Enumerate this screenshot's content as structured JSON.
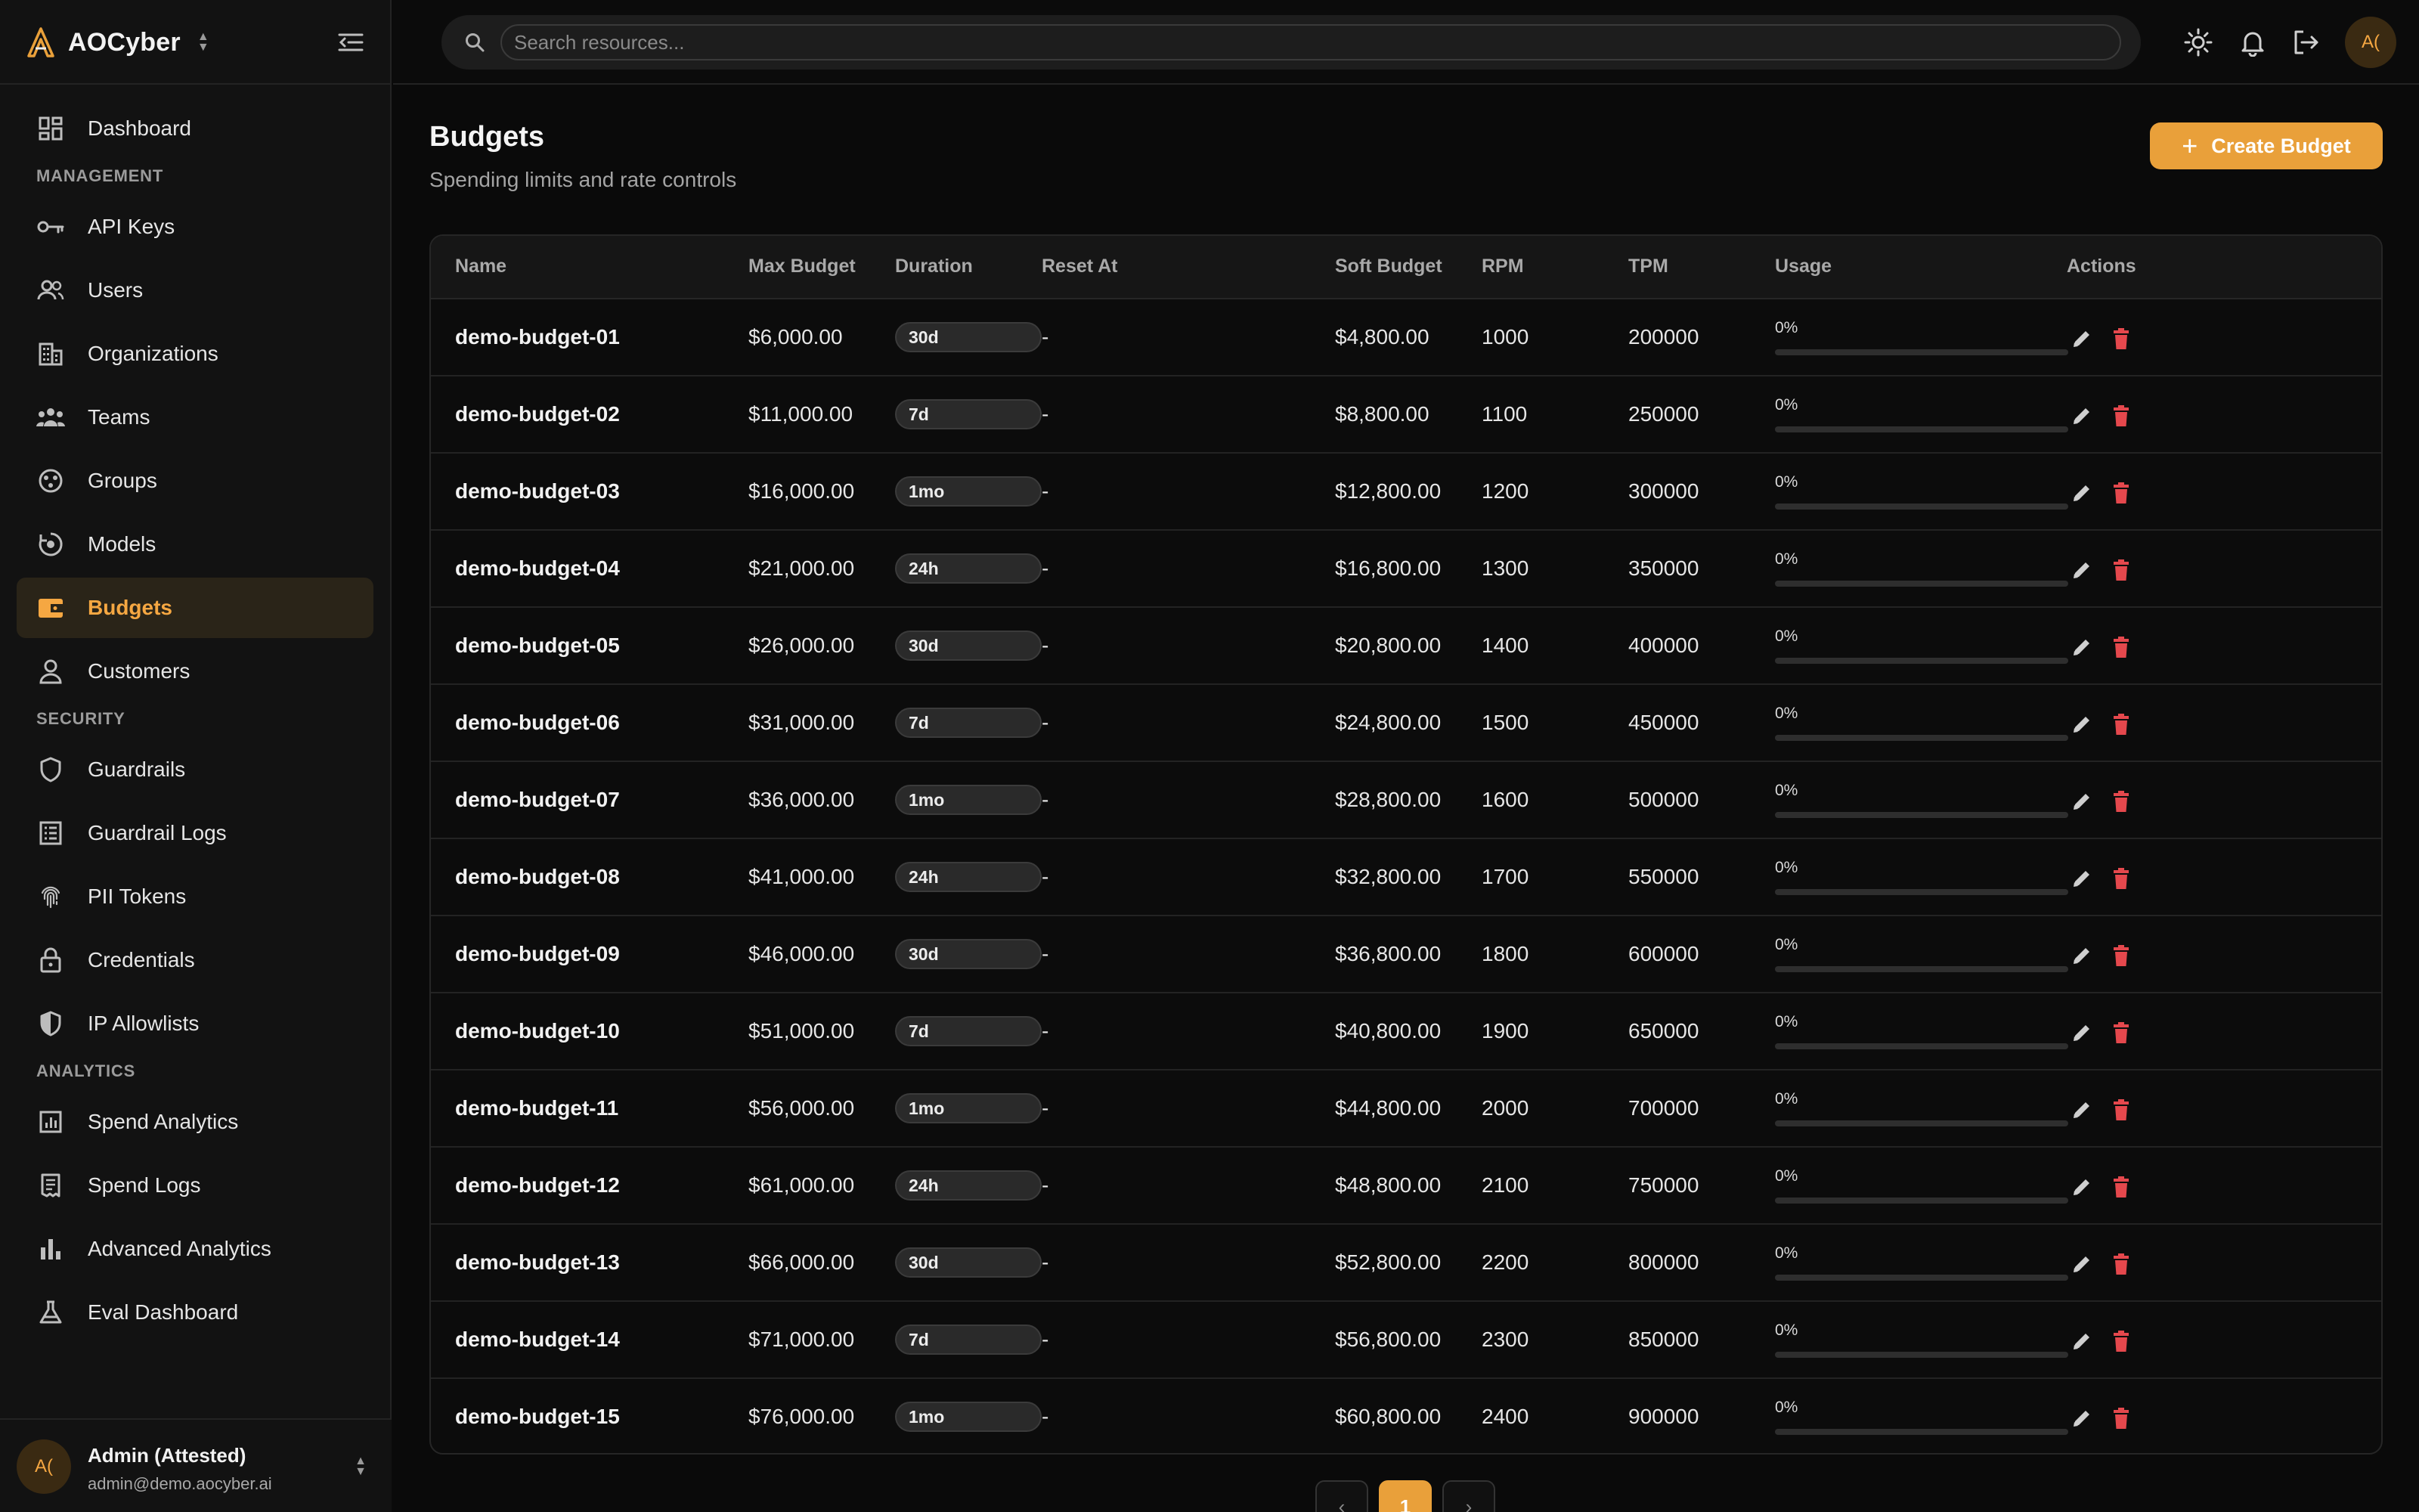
{
  "app": {
    "name": "AOCyber"
  },
  "search": {
    "placeholder": "Search resources..."
  },
  "sidebar": {
    "top_items": [
      {
        "label": "Dashboard",
        "icon": "dashboard-icon"
      }
    ],
    "sections": [
      {
        "title": "MANAGEMENT",
        "items": [
          {
            "label": "API Keys",
            "icon": "key-icon"
          },
          {
            "label": "Users",
            "icon": "users-icon"
          },
          {
            "label": "Organizations",
            "icon": "building-icon"
          },
          {
            "label": "Teams",
            "icon": "team-icon"
          },
          {
            "label": "Groups",
            "icon": "groups-icon"
          },
          {
            "label": "Models",
            "icon": "model-icon"
          },
          {
            "label": "Budgets",
            "icon": "wallet-icon",
            "active": true
          },
          {
            "label": "Customers",
            "icon": "person-icon"
          }
        ]
      },
      {
        "title": "SECURITY",
        "items": [
          {
            "label": "Guardrails",
            "icon": "shield-icon"
          },
          {
            "label": "Guardrail Logs",
            "icon": "list-icon"
          },
          {
            "label": "PII Tokens",
            "icon": "fingerprint-icon"
          },
          {
            "label": "Credentials",
            "icon": "lock-icon"
          },
          {
            "label": "IP Allowlists",
            "icon": "shield-half-icon"
          }
        ]
      },
      {
        "title": "ANALYTICS",
        "items": [
          {
            "label": "Spend Analytics",
            "icon": "analytics-icon"
          },
          {
            "label": "Spend Logs",
            "icon": "receipt-icon"
          },
          {
            "label": "Advanced Analytics",
            "icon": "bar-chart-icon"
          },
          {
            "label": "Eval Dashboard",
            "icon": "flask-icon"
          }
        ]
      }
    ]
  },
  "user": {
    "initials": "A(",
    "name": "Admin (Attested)",
    "email": "admin@demo.aocyber.ai"
  },
  "page": {
    "title": "Budgets",
    "subtitle": "Spending limits and rate controls",
    "create_label": "Create Budget"
  },
  "table": {
    "columns": [
      "Name",
      "Max Budget",
      "Duration",
      "Reset At",
      "Soft Budget",
      "RPM",
      "TPM",
      "Usage",
      "Actions"
    ],
    "rows": [
      {
        "name": "demo-budget-01",
        "max": "$6,000.00",
        "duration": "30d",
        "reset": "-",
        "soft": "$4,800.00",
        "rpm": "1000",
        "tpm": "200000",
        "usage": "0%",
        "usage_value": 0
      },
      {
        "name": "demo-budget-02",
        "max": "$11,000.00",
        "duration": "7d",
        "reset": "-",
        "soft": "$8,800.00",
        "rpm": "1100",
        "tpm": "250000",
        "usage": "0%",
        "usage_value": 0
      },
      {
        "name": "demo-budget-03",
        "max": "$16,000.00",
        "duration": "1mo",
        "reset": "-",
        "soft": "$12,800.00",
        "rpm": "1200",
        "tpm": "300000",
        "usage": "0%",
        "usage_value": 0
      },
      {
        "name": "demo-budget-04",
        "max": "$21,000.00",
        "duration": "24h",
        "reset": "-",
        "soft": "$16,800.00",
        "rpm": "1300",
        "tpm": "350000",
        "usage": "0%",
        "usage_value": 0
      },
      {
        "name": "demo-budget-05",
        "max": "$26,000.00",
        "duration": "30d",
        "reset": "-",
        "soft": "$20,800.00",
        "rpm": "1400",
        "tpm": "400000",
        "usage": "0%",
        "usage_value": 0
      },
      {
        "name": "demo-budget-06",
        "max": "$31,000.00",
        "duration": "7d",
        "reset": "-",
        "soft": "$24,800.00",
        "rpm": "1500",
        "tpm": "450000",
        "usage": "0%",
        "usage_value": 0
      },
      {
        "name": "demo-budget-07",
        "max": "$36,000.00",
        "duration": "1mo",
        "reset": "-",
        "soft": "$28,800.00",
        "rpm": "1600",
        "tpm": "500000",
        "usage": "0%",
        "usage_value": 0
      },
      {
        "name": "demo-budget-08",
        "max": "$41,000.00",
        "duration": "24h",
        "reset": "-",
        "soft": "$32,800.00",
        "rpm": "1700",
        "tpm": "550000",
        "usage": "0%",
        "usage_value": 0
      },
      {
        "name": "demo-budget-09",
        "max": "$46,000.00",
        "duration": "30d",
        "reset": "-",
        "soft": "$36,800.00",
        "rpm": "1800",
        "tpm": "600000",
        "usage": "0%",
        "usage_value": 0
      },
      {
        "name": "demo-budget-10",
        "max": "$51,000.00",
        "duration": "7d",
        "reset": "-",
        "soft": "$40,800.00",
        "rpm": "1900",
        "tpm": "650000",
        "usage": "0%",
        "usage_value": 0
      },
      {
        "name": "demo-budget-11",
        "max": "$56,000.00",
        "duration": "1mo",
        "reset": "-",
        "soft": "$44,800.00",
        "rpm": "2000",
        "tpm": "700000",
        "usage": "0%",
        "usage_value": 0
      },
      {
        "name": "demo-budget-12",
        "max": "$61,000.00",
        "duration": "24h",
        "reset": "-",
        "soft": "$48,800.00",
        "rpm": "2100",
        "tpm": "750000",
        "usage": "0%",
        "usage_value": 0
      },
      {
        "name": "demo-budget-13",
        "max": "$66,000.00",
        "duration": "30d",
        "reset": "-",
        "soft": "$52,800.00",
        "rpm": "2200",
        "tpm": "800000",
        "usage": "0%",
        "usage_value": 0
      },
      {
        "name": "demo-budget-14",
        "max": "$71,000.00",
        "duration": "7d",
        "reset": "-",
        "soft": "$56,800.00",
        "rpm": "2300",
        "tpm": "850000",
        "usage": "0%",
        "usage_value": 0
      },
      {
        "name": "demo-budget-15",
        "max": "$76,000.00",
        "duration": "1mo",
        "reset": "-",
        "soft": "$60,800.00",
        "rpm": "2400",
        "tpm": "900000",
        "usage": "0%",
        "usage_value": 0
      }
    ]
  },
  "pagination": {
    "prev": "‹",
    "current": "1",
    "next": "›"
  },
  "colors": {
    "accent": "#e9a03a",
    "danger": "#e5484d",
    "background": "#0a0a0a"
  }
}
